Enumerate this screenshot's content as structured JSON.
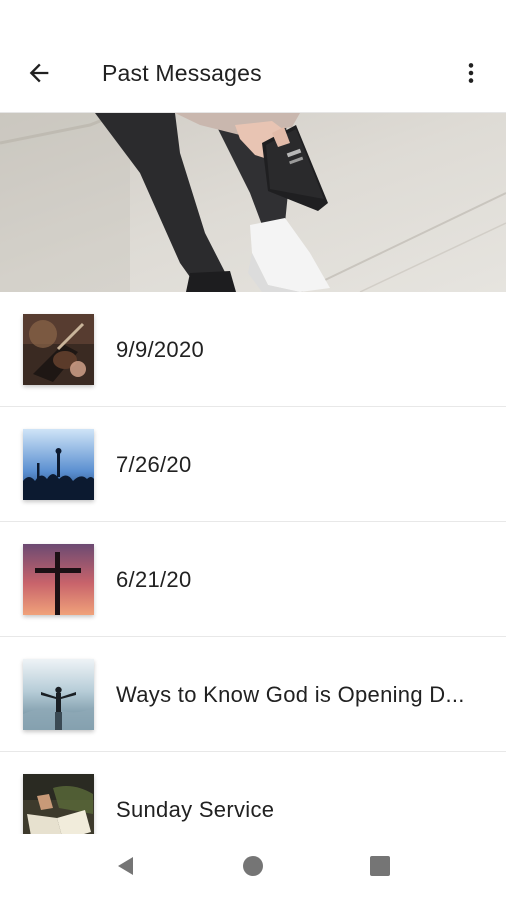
{
  "app_bar": {
    "title": "Past Messages",
    "back_icon": "arrow-back-icon",
    "menu_icon": "more-vert-icon"
  },
  "hero": {
    "image": "person-holding-bible-photo"
  },
  "messages": [
    {
      "label": "9/9/2020",
      "thumbnail": "guitar-worship-photo"
    },
    {
      "label": "7/26/20",
      "thumbnail": "concert-crowd-photo"
    },
    {
      "label": "6/21/20",
      "thumbnail": "cross-sunset-photo"
    },
    {
      "label": "Ways to Know God is Opening D...",
      "thumbnail": "man-arms-open-clouds-photo"
    },
    {
      "label": "Sunday Service",
      "thumbnail": "open-bible-reading-photo"
    }
  ],
  "nav_bar": {
    "back_icon": "nav-back-triangle-icon",
    "home_icon": "nav-home-circle-icon",
    "recents_icon": "nav-recents-square-icon"
  },
  "colors": {
    "text_primary": "#212121",
    "divider": "#e8e8e8",
    "nav_icon": "#757575"
  }
}
